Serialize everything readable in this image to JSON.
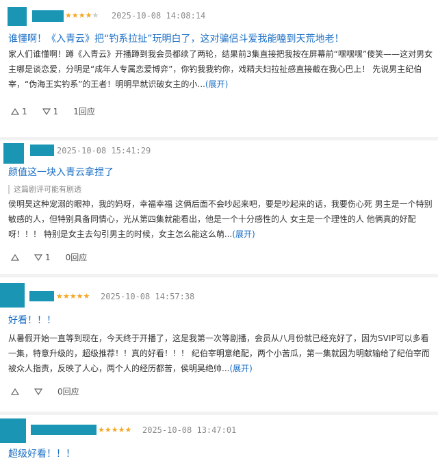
{
  "colors": {
    "accent": "#1b6fc5",
    "mask": "#1a96b4",
    "star": "#f5a623"
  },
  "reviews": [
    {
      "rating": 4,
      "date": "2025-10-08 14:08:14",
      "title": "谁懂啊！《入青云》把“钓系拉扯”玩明白了，这对骗侣斗爱我能嗑到天荒地老！",
      "body": [
        "家人们谁懂啊！蹲《入青云》开播蹲到我会员都续了两轮，结果前3集直接把我按在屏幕前“嘿嘿嘿”傻笑——这对男女",
        "主哪是谈恋爱，分明是“成年人专属恋爱博弈”，你钓我我钓你，戏精夫妇拉扯感直接截在我心巴上！ 先说男主纪伯",
        "宰，“伪海王实钓系”的王者！明明早就识破女主的小..."
      ],
      "expand": "(展开)",
      "up_count": "1",
      "down_count": "1",
      "reply": "1回应"
    },
    {
      "rating": 0,
      "date": "2025-10-08 15:41:29",
      "title": "颜值这一块入青云拿捏了",
      "spoiler": "这篇剧评可能有剧透",
      "body": [
        "侯明昊这种宠溺的眼神，我的妈呀，幸福幸福 这俩后面不会吵起来吧，要是吵起来的话，我要伤心死 男主是一个特别",
        "敏感的人，但特别具备同情心，光从第四集就能看出，他是一个十分感性的人 女主是一个理性的人 他俩真的好配",
        "呀！！！ 特别是女主去勾引男主的时候，女主怎么能这么萌..."
      ],
      "expand": "(展开)",
      "up_count": "",
      "down_count": "1",
      "reply": "0回应"
    },
    {
      "rating": 5,
      "date": "2025-10-08 14:57:38",
      "title": "好看！！！",
      "body": [
        "从暑假开始一直等到现在，今天终于开播了，这是我第一次等剧播，会员从八月份就已经充好了，因为SVIP可以多看",
        "一集，特意升级的，超级推荐！！真的好看！！！ 纪伯宰明意绝配，两个小苦瓜，第一集就因为明献输给了纪伯宰而",
        "被众人指责，反映了人心，两个人的经历都苦，侯明昊绝帅..."
      ],
      "expand": "(展开)",
      "up_count": "",
      "down_count": "",
      "reply": "0回应"
    },
    {
      "rating": 5,
      "date": "2025-10-08 13:47:01",
      "title": "超级好看！！！"
    }
  ]
}
